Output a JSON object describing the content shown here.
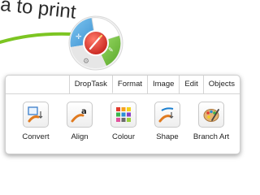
{
  "background": {
    "text": "a to print"
  },
  "radial_menu": {
    "accent": "#d33"
  },
  "tabs": [
    {
      "label": "DropTask",
      "active": false
    },
    {
      "label": "Format",
      "active": true
    },
    {
      "label": "Image",
      "active": false
    },
    {
      "label": "Edit",
      "active": false
    },
    {
      "label": "Objects",
      "active": false
    }
  ],
  "tools": [
    {
      "label": "Convert",
      "icon": "convert-icon"
    },
    {
      "label": "Align",
      "icon": "align-icon"
    },
    {
      "label": "Colour",
      "icon": "colour-icon"
    },
    {
      "label": "Shape",
      "icon": "shape-icon"
    },
    {
      "label": "Branch Art",
      "icon": "branch-art-icon"
    }
  ]
}
